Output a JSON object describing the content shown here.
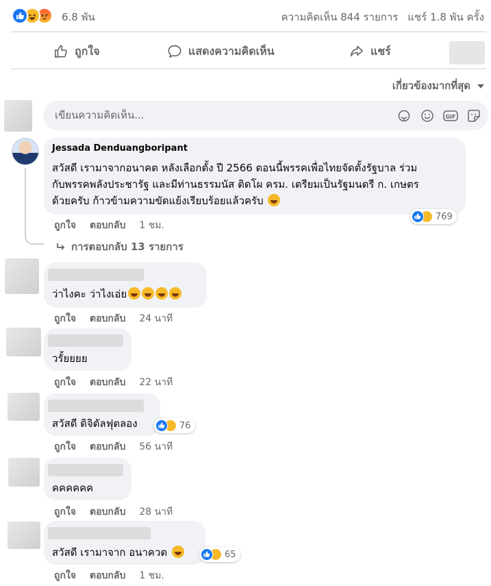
{
  "stats": {
    "reaction_count": "6.8 พัน",
    "comments": "ความคิดเห็น 844 รายการ",
    "shares": "แชร์ 1.8 พัน ครั้ง",
    "reaction_icons": [
      "like-icon",
      "haha-icon",
      "angry-icon"
    ]
  },
  "actions": {
    "like": "ถูกใจ",
    "comment": "แสดงความคิดเห็น",
    "share": "แชร์"
  },
  "sort": {
    "label": "เกี่ยวข้องมากที่สุด"
  },
  "composer": {
    "placeholder": "เขียนความคิดเห็น...",
    "icons": [
      "sticker-icon",
      "emoji-icon",
      "gif-icon",
      "sticker-sheet-icon"
    ]
  },
  "labels": {
    "like": "ถูกใจ",
    "reply": "ตอบกลับ"
  },
  "comments": [
    {
      "author": "Jessada Denduangboripant",
      "lines": [
        "สวัสดี เรามาจากอนาคต หลังเลือกตั้ง ปี 2566 ตอนนี้พรรคเพื่อไทยจัดตั้งรัฐบาล ร่วม",
        "กับพรรคพลังประชารัฐ และมีท่านธรรมนัส ติดโผ ครม. เตรียมเป็นรัฐมนตรี ก. เกษตร",
        "ด้วยครับ ก้าวข้ามความขัดแย้งเรียบร้อยแล้วครับ"
      ],
      "time": "1 ชม.",
      "reactions": "769",
      "replies": "การตอบกลับ 13 รายการ"
    },
    {
      "text": "ว่าไงคะ ว่าไงเอ่ย",
      "time": "24 นาที"
    },
    {
      "text": "วรั้ยยยย",
      "time": "22 นาที"
    },
    {
      "text": "สวัสดี ดิจิตัลฟุตลอง",
      "time": "56 นาที",
      "reactions": "76"
    },
    {
      "text": "คคคคคค",
      "time": "28 นาที"
    },
    {
      "text": "สวัสดี เรามาจาก อนาควต",
      "time": "1 ชม.",
      "reactions": "65"
    }
  ]
}
